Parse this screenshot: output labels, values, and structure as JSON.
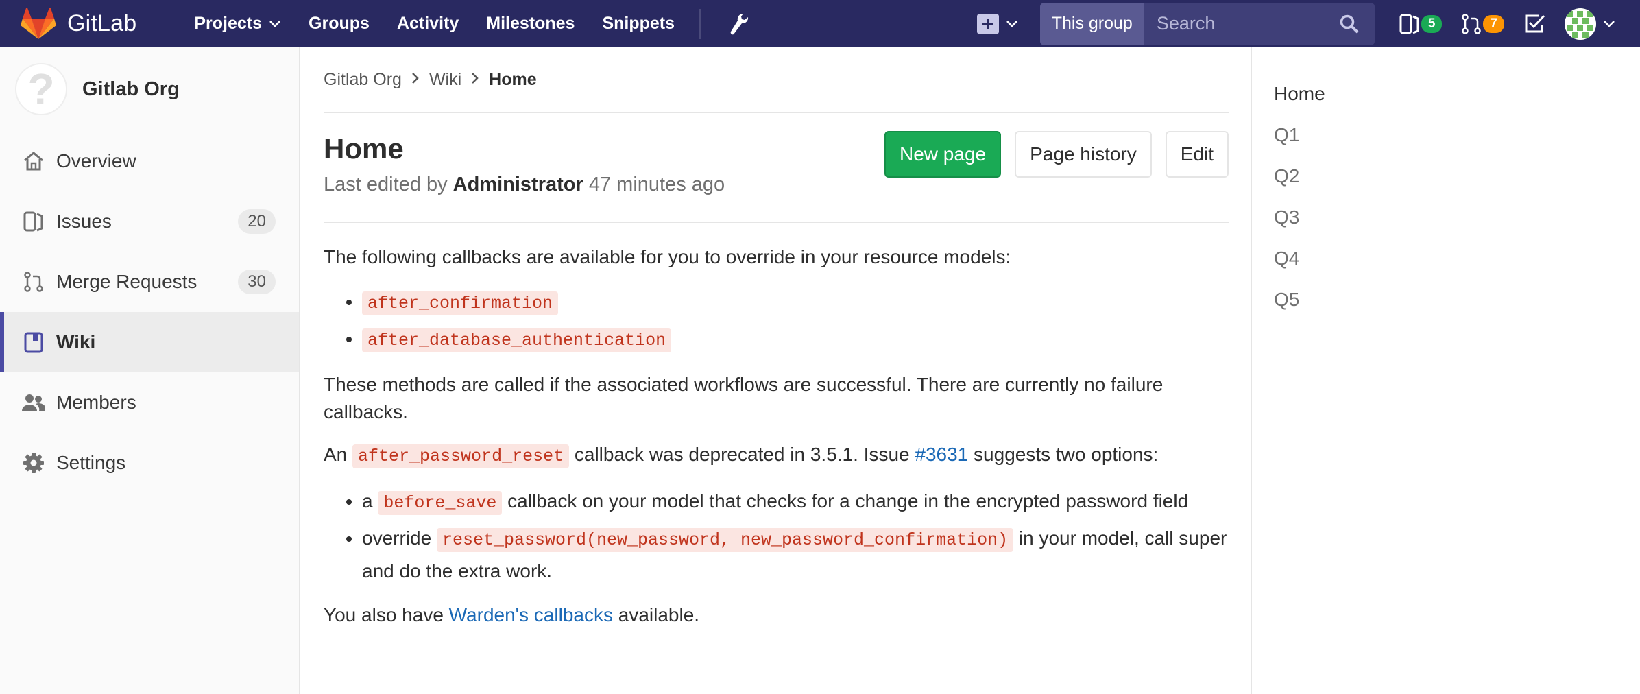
{
  "navbar": {
    "brand": "GitLab",
    "links": [
      {
        "label": "Projects",
        "dropdown": true
      },
      {
        "label": "Groups",
        "dropdown": false
      },
      {
        "label": "Activity",
        "dropdown": false
      },
      {
        "label": "Milestones",
        "dropdown": false
      },
      {
        "label": "Snippets",
        "dropdown": false
      }
    ],
    "search": {
      "scope": "This group",
      "placeholder": "Search"
    },
    "issues_count": "5",
    "merge_requests_count": "7",
    "colors": {
      "bg": "#292961",
      "issues_badge": "#1aaa55",
      "mr_badge": "#fc9403"
    }
  },
  "sidebar": {
    "group_name": "Gitlab Org",
    "items": [
      {
        "label": "Overview",
        "icon": "home-icon",
        "count": null,
        "active": false
      },
      {
        "label": "Issues",
        "icon": "issues-icon",
        "count": "20",
        "active": false
      },
      {
        "label": "Merge Requests",
        "icon": "merge-request-icon",
        "count": "30",
        "active": false
      },
      {
        "label": "Wiki",
        "icon": "book-icon",
        "count": null,
        "active": true
      },
      {
        "label": "Members",
        "icon": "users-icon",
        "count": null,
        "active": false
      },
      {
        "label": "Settings",
        "icon": "gear-icon",
        "count": null,
        "active": false
      }
    ]
  },
  "breadcrumb": {
    "items": [
      "Gitlab Org",
      "Wiki"
    ],
    "current": "Home"
  },
  "page": {
    "title": "Home",
    "last_edited_prefix": "Last edited by",
    "author": "Administrator",
    "time_ago": "47 minutes ago",
    "buttons": {
      "new_page": "New page",
      "page_history": "Page history",
      "edit": "Edit"
    }
  },
  "content": {
    "intro": "The following callbacks are available for you to override in your resource models:",
    "callbacks": [
      "after_confirmation",
      "after_database_authentication"
    ],
    "methods_note": "These methods are called if the associated workflows are successful. There are currently no failure callbacks.",
    "deprecated": {
      "prefix": "An",
      "code": "after_password_reset",
      "middle": "callback was deprecated in 3.5.1. Issue",
      "issue_link": "#3631",
      "suffix": "suggests two options:"
    },
    "options": [
      {
        "prefix": "a",
        "code": "before_save",
        "suffix": "callback on your model that checks for a change in the encrypted password field"
      },
      {
        "prefix": "override",
        "code": "reset_password(new_password, new_password_confirmation)",
        "suffix": "in your model, call super and do the extra work."
      }
    ],
    "warden": {
      "prefix": "You also have",
      "link": "Warden's callbacks",
      "suffix": "available."
    }
  },
  "wiki_pages": [
    "Home",
    "Q1",
    "Q2",
    "Q3",
    "Q4",
    "Q5"
  ]
}
